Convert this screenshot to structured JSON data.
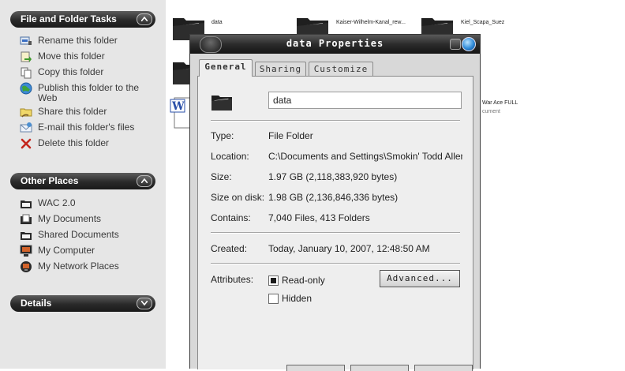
{
  "task_pane": {
    "file_folder_tasks": {
      "title": "File and Folder Tasks",
      "items": [
        {
          "label": "Rename this folder",
          "icon": "rename-icon"
        },
        {
          "label": "Move this folder",
          "icon": "move-icon"
        },
        {
          "label": "Copy this folder",
          "icon": "copy-icon"
        },
        {
          "label": "Publish this folder to the Web",
          "icon": "globe-icon"
        },
        {
          "label": "Share this folder",
          "icon": "share-icon"
        },
        {
          "label": "E-mail this folder's files",
          "icon": "email-icon"
        },
        {
          "label": "Delete this folder",
          "icon": "delete-icon"
        }
      ]
    },
    "other_places": {
      "title": "Other Places",
      "items": [
        {
          "label": "WAC 2.0",
          "icon": "folder-icon"
        },
        {
          "label": "My Documents",
          "icon": "my-documents-icon"
        },
        {
          "label": "Shared Documents",
          "icon": "folder-icon"
        },
        {
          "label": "My Computer",
          "icon": "computer-icon"
        },
        {
          "label": "My Network Places",
          "icon": "network-icon"
        }
      ]
    },
    "details": {
      "title": "Details"
    }
  },
  "files": [
    {
      "label": "data"
    },
    {
      "label": "Kaiser-Wilhelm-Kanal_rew..."
    },
    {
      "label": "Kiel_Scapa_Suez"
    },
    {
      "label": "War Ace FULL"
    },
    {
      "label": "cument"
    }
  ],
  "dialog": {
    "title": "data Properties",
    "tabs": [
      {
        "label": "General"
      },
      {
        "label": "Sharing"
      },
      {
        "label": "Customize"
      }
    ],
    "folder_name": "data",
    "properties": {
      "type_label": "Type:",
      "type_value": "File Folder",
      "location_label": "Location:",
      "location_value": "C:\\Documents and Settings\\Smokin' Todd Allen\\De",
      "size_label": "Size:",
      "size_value": "1.97 GB (2,118,383,920 bytes)",
      "size_on_disk_label": "Size on disk:",
      "size_on_disk_value": "1.98 GB (2,136,846,336 bytes)",
      "contains_label": "Contains:",
      "contains_value": "7,040 Files, 413 Folders",
      "created_label": "Created:",
      "created_value": "Today, January 10, 2007, 12:48:50 AM",
      "attributes_label": "Attributes:",
      "readonly_label": "Read-only",
      "hidden_label": "Hidden",
      "advanced_label": "Advanced..."
    }
  }
}
